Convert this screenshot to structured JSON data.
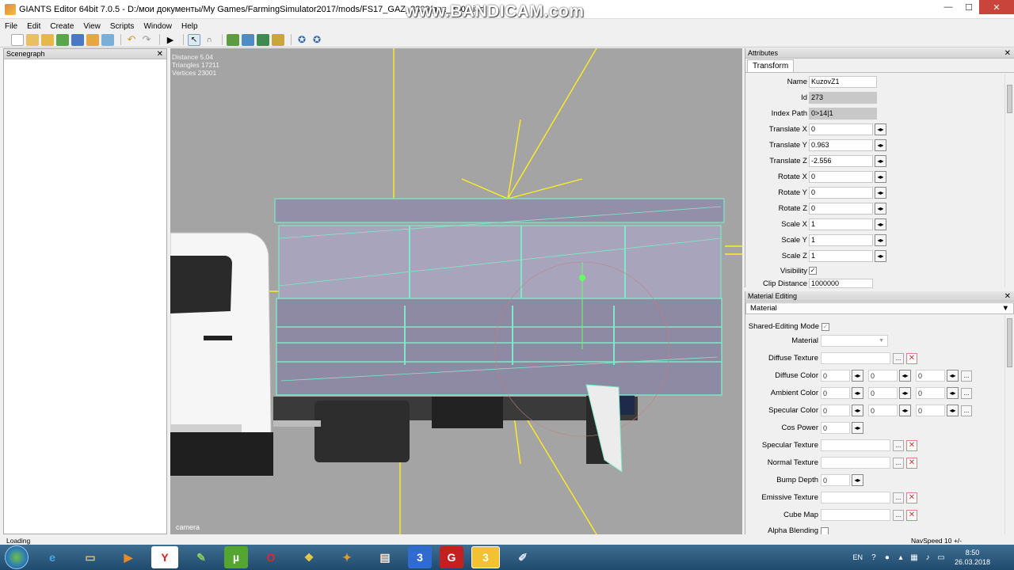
{
  "window": {
    "title": "GIANTS Editor 64bit 7.0.5 - D:/мои документы/My Games/FarmingSimulator2017/mods/FS17_GAZ_3309/gaz_3307.i3d",
    "watermark": "www.BANDICAM.com",
    "min_label": "—",
    "max_label": "☐",
    "close_label": "✕"
  },
  "menu": [
    "File",
    "Edit",
    "Create",
    "View",
    "Scripts",
    "Window",
    "Help"
  ],
  "toolbar_icons": [
    "new-icon",
    "open-icon",
    "edit-icon",
    "refresh-icon",
    "save-icon",
    "export-icon",
    "import-icon",
    "undo-icon",
    "redo-icon",
    "play-icon",
    "select-icon",
    "move-icon",
    "terrain-icon",
    "paint-icon",
    "foliage-icon",
    "brush-icon",
    "settings-icon",
    "gizmo-icon"
  ],
  "scenegraph": {
    "title": "Scenegraph",
    "close": "✕"
  },
  "viewport": {
    "stats": [
      "Distance 5.04",
      "Triangles 17211",
      "Vertices 23001"
    ],
    "camera_label": "camera"
  },
  "attributes": {
    "title": "Attributes",
    "close": "✕",
    "tab": "Transform",
    "name_label": "Name",
    "name_value": "KuzovZ1",
    "id_label": "Id",
    "id_value": "273",
    "index_label": "Index Path",
    "index_value": "0>14|1",
    "tx_label": "Translate X",
    "tx_value": "0",
    "ty_label": "Translate Y",
    "ty_value": "0.963",
    "tz_label": "Translate Z",
    "tz_value": "-2.556",
    "rx_label": "Rotate X",
    "rx_value": "0",
    "ry_label": "Rotate Y",
    "ry_value": "0",
    "rz_label": "Rotate Z",
    "rz_value": "0",
    "sx_label": "Scale X",
    "sx_value": "1",
    "sy_label": "Scale Y",
    "sy_value": "1",
    "sz_label": "Scale Z",
    "sz_value": "1",
    "vis_label": "Visibility",
    "vis_checked": "✓",
    "clip_label": "Clip Distance",
    "clip_value": "1000000"
  },
  "material": {
    "title": "Material Editing",
    "close": "✕",
    "dropdown": "Material",
    "shared_label": "Shared-Editing Mode",
    "shared_checked": "✓",
    "material_label": "Material",
    "diffuse_tex_label": "Diffuse Texture",
    "diffuse_color_label": "Diffuse Color",
    "diffuse_values": [
      "0",
      "0",
      "0"
    ],
    "ambient_label": "Ambient Color",
    "ambient_values": [
      "0",
      "0",
      "0"
    ],
    "specular_color_label": "Specular Color",
    "specular_values": [
      "0",
      "0",
      "0"
    ],
    "cos_label": "Cos Power",
    "cos_value": "0",
    "specular_tex_label": "Specular Texture",
    "normal_tex_label": "Normal Texture",
    "bump_label": "Bump Depth",
    "bump_value": "0",
    "emissive_label": "Emissive Texture",
    "cube_label": "Cube Map",
    "alpha_label": "Alpha Blending",
    "browse": "...",
    "remove": "✕",
    "spin": "◂▸",
    "dropdown_arrow": "▼"
  },
  "status": {
    "left": "Loading",
    "right": "NavSpeed 10 +/-"
  },
  "taskbar": {
    "apps": [
      "internet-explorer-icon",
      "folder-icon",
      "media-player-icon",
      "yandex-icon",
      "notepad-icon",
      "utorrent-icon",
      "opera-icon",
      "cheat-icon",
      "cat-icon",
      "window-icon",
      "app3-icon",
      "giants-icon",
      "editor3-icon",
      "paint-icon"
    ],
    "app_glyphs": [
      "e",
      "▭",
      "▶",
      "Y",
      "✎",
      "µ",
      "O",
      "❖",
      "✦",
      "▤",
      "3",
      "G",
      "3",
      "✐"
    ],
    "lang": "EN",
    "help": "?",
    "time": "8:50",
    "date": "26.03.2018"
  }
}
